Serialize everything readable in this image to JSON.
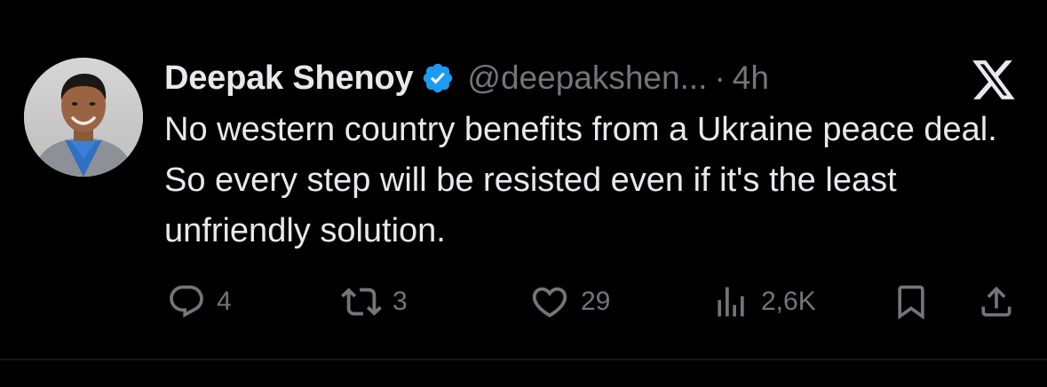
{
  "author": {
    "display_name": "Deepak Shenoy",
    "handle": "@deepakshen...",
    "separator": "·",
    "time": "4h",
    "verified": true
  },
  "tweet": {
    "text": "No western country benefits from a Ukraine peace deal. So every step will be resisted even if it's the least unfriendly solution."
  },
  "actions": {
    "reply_count": "4",
    "retweet_count": "3",
    "like_count": "29",
    "view_count": "2,6K"
  },
  "icons": {
    "brand": "x-logo-icon",
    "verified": "verified-badge-icon",
    "reply": "reply-icon",
    "retweet": "retweet-icon",
    "like": "heart-icon",
    "views": "views-icon",
    "bookmark": "bookmark-icon",
    "share": "share-icon"
  },
  "colors": {
    "background": "#000000",
    "text_primary": "#e7e9ea",
    "text_secondary": "#71767b",
    "verified_blue": "#1d9bf0"
  }
}
